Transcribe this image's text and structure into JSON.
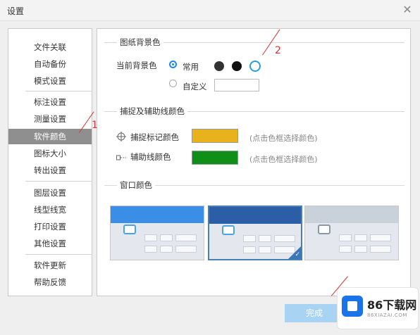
{
  "window": {
    "title": "设置",
    "close_glyph": "✕"
  },
  "sidebar": {
    "items": [
      "文件关联",
      "自动备份",
      "模式设置",
      "标注设置",
      "测量设置",
      "软件颜色",
      "图标大小",
      "转出设置",
      "图层设置",
      "线型线宽",
      "打印设置",
      "其他设置",
      "软件更新",
      "帮助反馈"
    ],
    "selected": "软件颜色"
  },
  "canvas_bg": {
    "title": "图纸背景色",
    "current_label": "当前背景色",
    "common_label": "常用",
    "custom_label": "自定义",
    "swatches": [
      {
        "name": "dark-gray",
        "color": "#333333"
      },
      {
        "name": "black",
        "color": "#111111"
      },
      {
        "name": "white-selected",
        "color": "#ffffff"
      }
    ],
    "selected_option": "常用"
  },
  "snap_colors": {
    "title": "捕捉及辅助线颜色",
    "snap_label": "捕捉标记颜色",
    "snap_color": "#e8b21c",
    "aux_label": "辅助线颜色",
    "aux_color": "#0f8f17",
    "hint": "(点击色框选择颜色)"
  },
  "window_color": {
    "title": "窗口颜色",
    "themes": [
      {
        "name": "blue",
        "header_color": "#3a8ee6",
        "selected": false
      },
      {
        "name": "dark-blue",
        "header_color": "#2c5ea8",
        "selected": true
      },
      {
        "name": "gray",
        "header_color": "#c9d1da",
        "selected": false
      }
    ]
  },
  "footer": {
    "done_label": "完成"
  },
  "watermark": {
    "name": "86下载网",
    "domain": "86XIAZAI.COM"
  },
  "annotations": {
    "n1": "1",
    "n2": "2"
  },
  "colors": {
    "accent": "#1e88e5",
    "selected_row": "#8f8f8f",
    "done_button": "#a9d3f3"
  }
}
